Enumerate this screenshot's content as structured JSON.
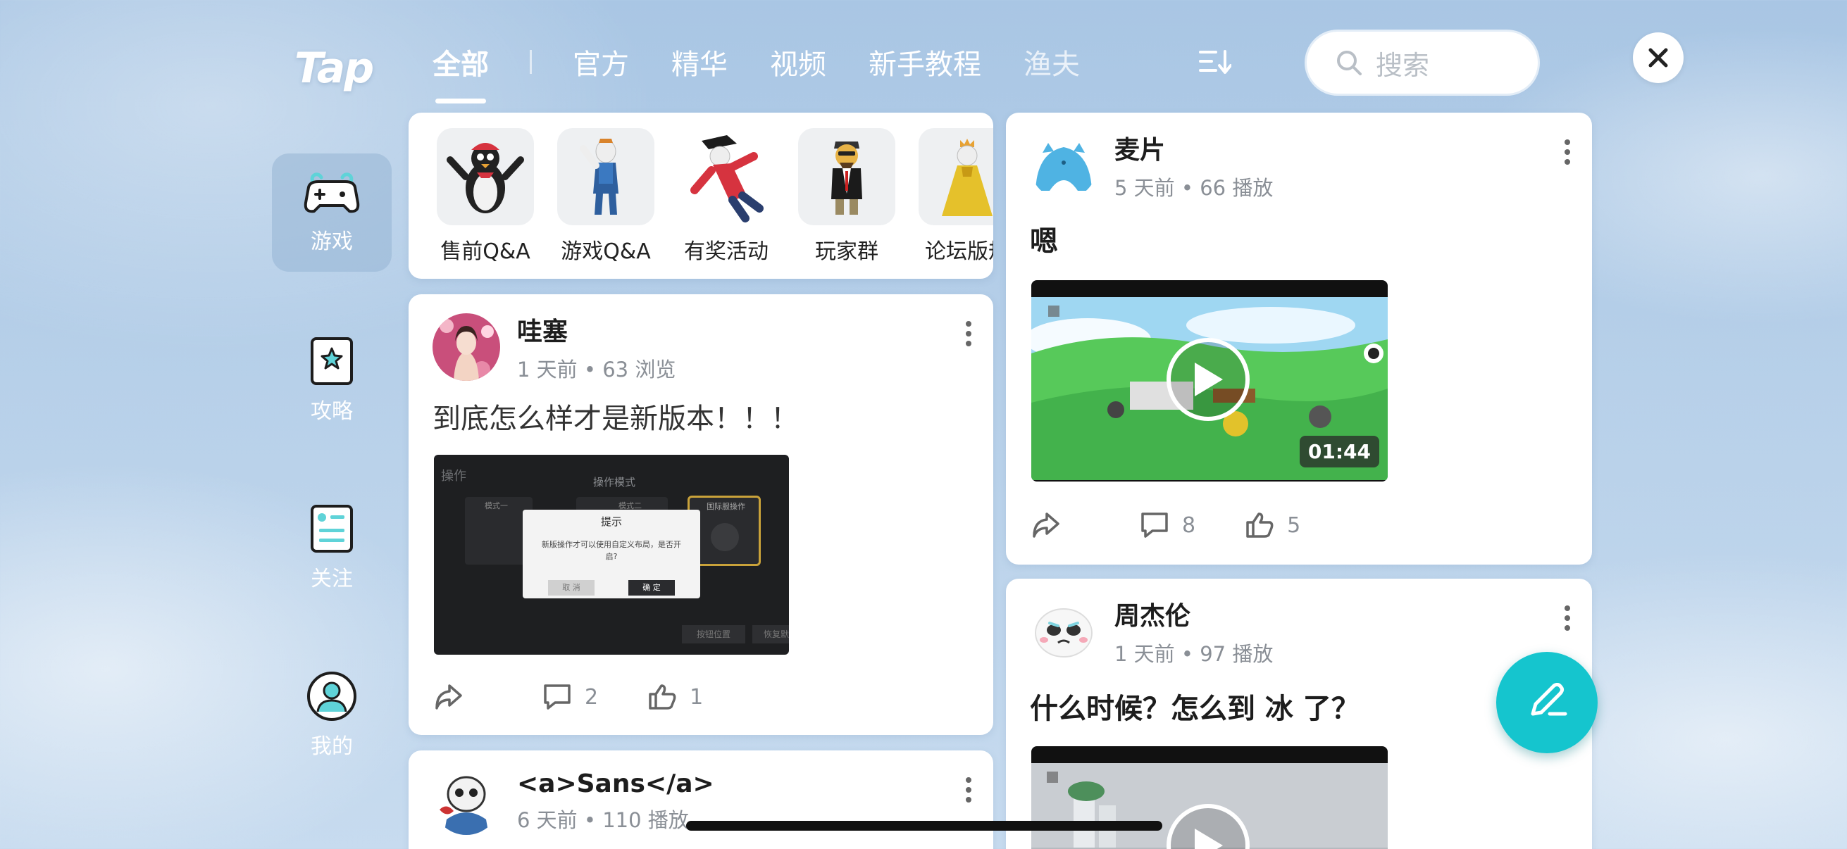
{
  "header": {
    "logo": "Tap",
    "tabs": [
      "全部",
      "官方",
      "精华",
      "视频",
      "新手教程",
      "渔夫"
    ],
    "active_tab": "全部",
    "search_placeholder": "搜索"
  },
  "sidebar": {
    "items": [
      {
        "label": "游戏",
        "icon": "gamepad-icon",
        "active": true
      },
      {
        "label": "攻略",
        "icon": "star-book-icon",
        "active": false
      },
      {
        "label": "关注",
        "icon": "follow-list-icon",
        "active": false
      },
      {
        "label": "我的",
        "icon": "user-icon",
        "active": false
      }
    ]
  },
  "categories": [
    {
      "label": "售前Q&A",
      "icon": "penguin-character"
    },
    {
      "label": "游戏Q&A",
      "icon": "worker-character"
    },
    {
      "label": "有奖活动",
      "icon": "pirate-character"
    },
    {
      "label": "玩家群",
      "icon": "suit-character"
    },
    {
      "label": "论坛版规",
      "icon": "queen-character"
    }
  ],
  "posts": [
    {
      "author": "哇塞",
      "meta": "1 天前 • 63 浏览",
      "text": "到底怎么样才是新版本！！！",
      "image": {
        "title": "操作",
        "subtitle": "操作模式",
        "mode1": "模式一",
        "mode2": "模式二",
        "intl": "国际服操作",
        "dialog_title": "提示",
        "dialog_msg": "新版操作才可以使用自定义布局，是否开启?",
        "dialog_cancel": "取 消",
        "dialog_ok": "确 定",
        "btn1": "按钮位置",
        "btn2": "恢复默"
      },
      "comments": "2",
      "likes": "1"
    },
    {
      "author": "<a>Sans</a>",
      "meta": "6 天前 • 110 播放"
    },
    {
      "author": "麦片",
      "meta": "5 天前 • 66 播放",
      "text": "嗯",
      "duration": "01:44",
      "comments": "8",
      "likes": "5"
    },
    {
      "author": "周杰伦",
      "meta": "1 天前 • 97 播放",
      "text": "什么时候？怎么到 冰 了？"
    }
  ],
  "colors": {
    "accent": "#15c5ce",
    "bg": "#b7d0e9"
  }
}
